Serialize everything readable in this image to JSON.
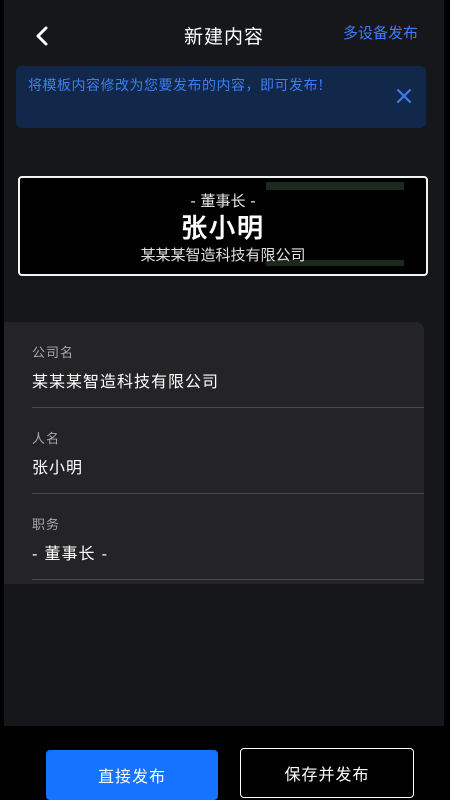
{
  "header": {
    "title": "新建内容",
    "multi_publish": "多设备发布"
  },
  "notice": {
    "text": "将模板内容修改为您要发布的内容，即可发布!"
  },
  "preview": {
    "role": "- 董事长 -",
    "name": "张小明",
    "company": "某某某智造科技有限公司"
  },
  "form": {
    "fields": [
      {
        "label": "公司名",
        "value": "某某某智造科技有限公司"
      },
      {
        "label": "人名",
        "value": "张小明"
      },
      {
        "label": "职务",
        "value": "- 董事长 -"
      }
    ]
  },
  "actions": {
    "direct_publish": "直接发布",
    "save_publish": "保存并发布"
  },
  "icons": {
    "back": "chevron-left-icon",
    "close": "close-icon"
  },
  "colors": {
    "accent": "#1573ff",
    "link": "#3f7bff",
    "notice_bg": "#12284a",
    "background": "#16171b"
  }
}
